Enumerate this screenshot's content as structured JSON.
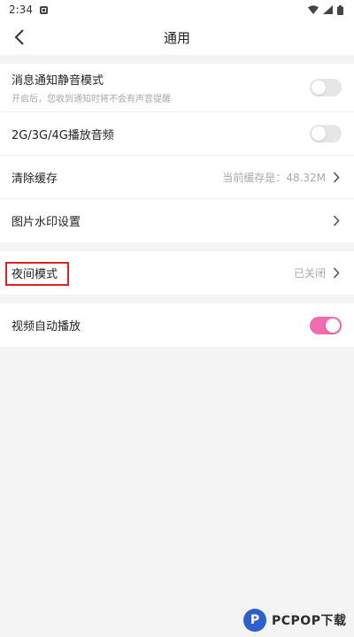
{
  "status_bar": {
    "time": "2:34"
  },
  "header": {
    "title": "通用"
  },
  "group1": [
    {
      "label": "消息通知静音模式",
      "sublabel": "开启后，您收到通知时将不会有声音提醒",
      "control": "toggle",
      "on": false
    },
    {
      "label": "2G/3G/4G播放音频",
      "control": "toggle",
      "on": false
    },
    {
      "label": "清除缓存",
      "value": "当前缓存是：48.32M",
      "control": "chevron"
    },
    {
      "label": "图片水印设置",
      "control": "chevron"
    }
  ],
  "night_mode": {
    "label": "夜间模式",
    "value": "已关闭"
  },
  "autoplay": {
    "label": "视频自动播放",
    "on": true
  },
  "colors": {
    "accent": "#f06bb0",
    "highlight": "#e02020"
  },
  "watermark": {
    "text": "PCPOP下载"
  }
}
